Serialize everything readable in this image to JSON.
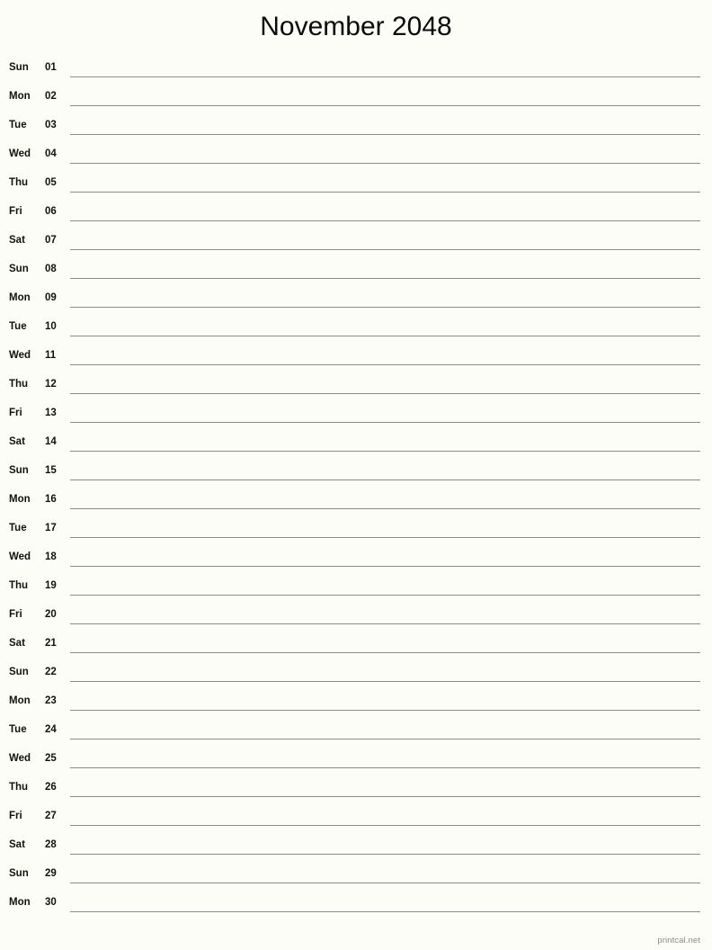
{
  "header": {
    "title": "November 2048"
  },
  "footer": {
    "attribution": "printcal.net"
  },
  "colors": {
    "background": "#fdfdf8",
    "text": "#0a0a0a",
    "rule": "#8b8b88",
    "footer_text": "#8a8a87"
  },
  "calendar": {
    "month": "November",
    "year": "2048",
    "layout": "single-column-notes",
    "rows": [
      {
        "dow": "Sun",
        "dom": "01"
      },
      {
        "dow": "Mon",
        "dom": "02"
      },
      {
        "dow": "Tue",
        "dom": "03"
      },
      {
        "dow": "Wed",
        "dom": "04"
      },
      {
        "dow": "Thu",
        "dom": "05"
      },
      {
        "dow": "Fri",
        "dom": "06"
      },
      {
        "dow": "Sat",
        "dom": "07"
      },
      {
        "dow": "Sun",
        "dom": "08"
      },
      {
        "dow": "Mon",
        "dom": "09"
      },
      {
        "dow": "Tue",
        "dom": "10"
      },
      {
        "dow": "Wed",
        "dom": "11"
      },
      {
        "dow": "Thu",
        "dom": "12"
      },
      {
        "dow": "Fri",
        "dom": "13"
      },
      {
        "dow": "Sat",
        "dom": "14"
      },
      {
        "dow": "Sun",
        "dom": "15"
      },
      {
        "dow": "Mon",
        "dom": "16"
      },
      {
        "dow": "Tue",
        "dom": "17"
      },
      {
        "dow": "Wed",
        "dom": "18"
      },
      {
        "dow": "Thu",
        "dom": "19"
      },
      {
        "dow": "Fri",
        "dom": "20"
      },
      {
        "dow": "Sat",
        "dom": "21"
      },
      {
        "dow": "Sun",
        "dom": "22"
      },
      {
        "dow": "Mon",
        "dom": "23"
      },
      {
        "dow": "Tue",
        "dom": "24"
      },
      {
        "dow": "Wed",
        "dom": "25"
      },
      {
        "dow": "Thu",
        "dom": "26"
      },
      {
        "dow": "Fri",
        "dom": "27"
      },
      {
        "dow": "Sat",
        "dom": "28"
      },
      {
        "dow": "Sun",
        "dom": "29"
      },
      {
        "dow": "Mon",
        "dom": "30"
      }
    ]
  }
}
